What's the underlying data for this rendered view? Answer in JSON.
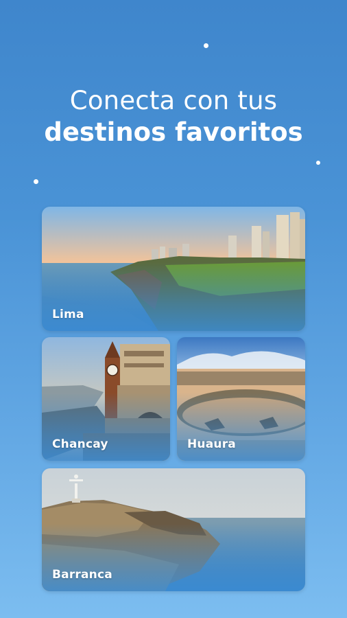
{
  "headline": {
    "line1": "Conecta con tus",
    "line2": "destinos favoritos"
  },
  "destinations": [
    {
      "name": "Lima"
    },
    {
      "name": "Chancay"
    },
    {
      "name": "Huaura"
    },
    {
      "name": "Barranca"
    }
  ],
  "colors": {
    "background_top": "#3f86cc",
    "background_bottom": "#7cbdf0",
    "text": "#ffffff"
  }
}
